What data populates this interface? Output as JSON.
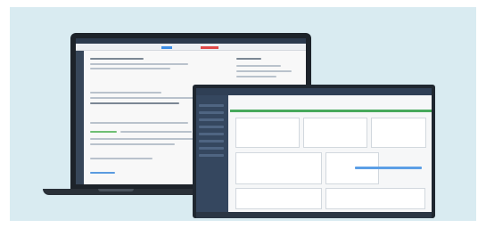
{
  "scene": {
    "background_color": "#d9ebf1",
    "devices": [
      "laptop",
      "monitor"
    ]
  },
  "icons": [
    "laptop-icon",
    "monitor-icon"
  ]
}
